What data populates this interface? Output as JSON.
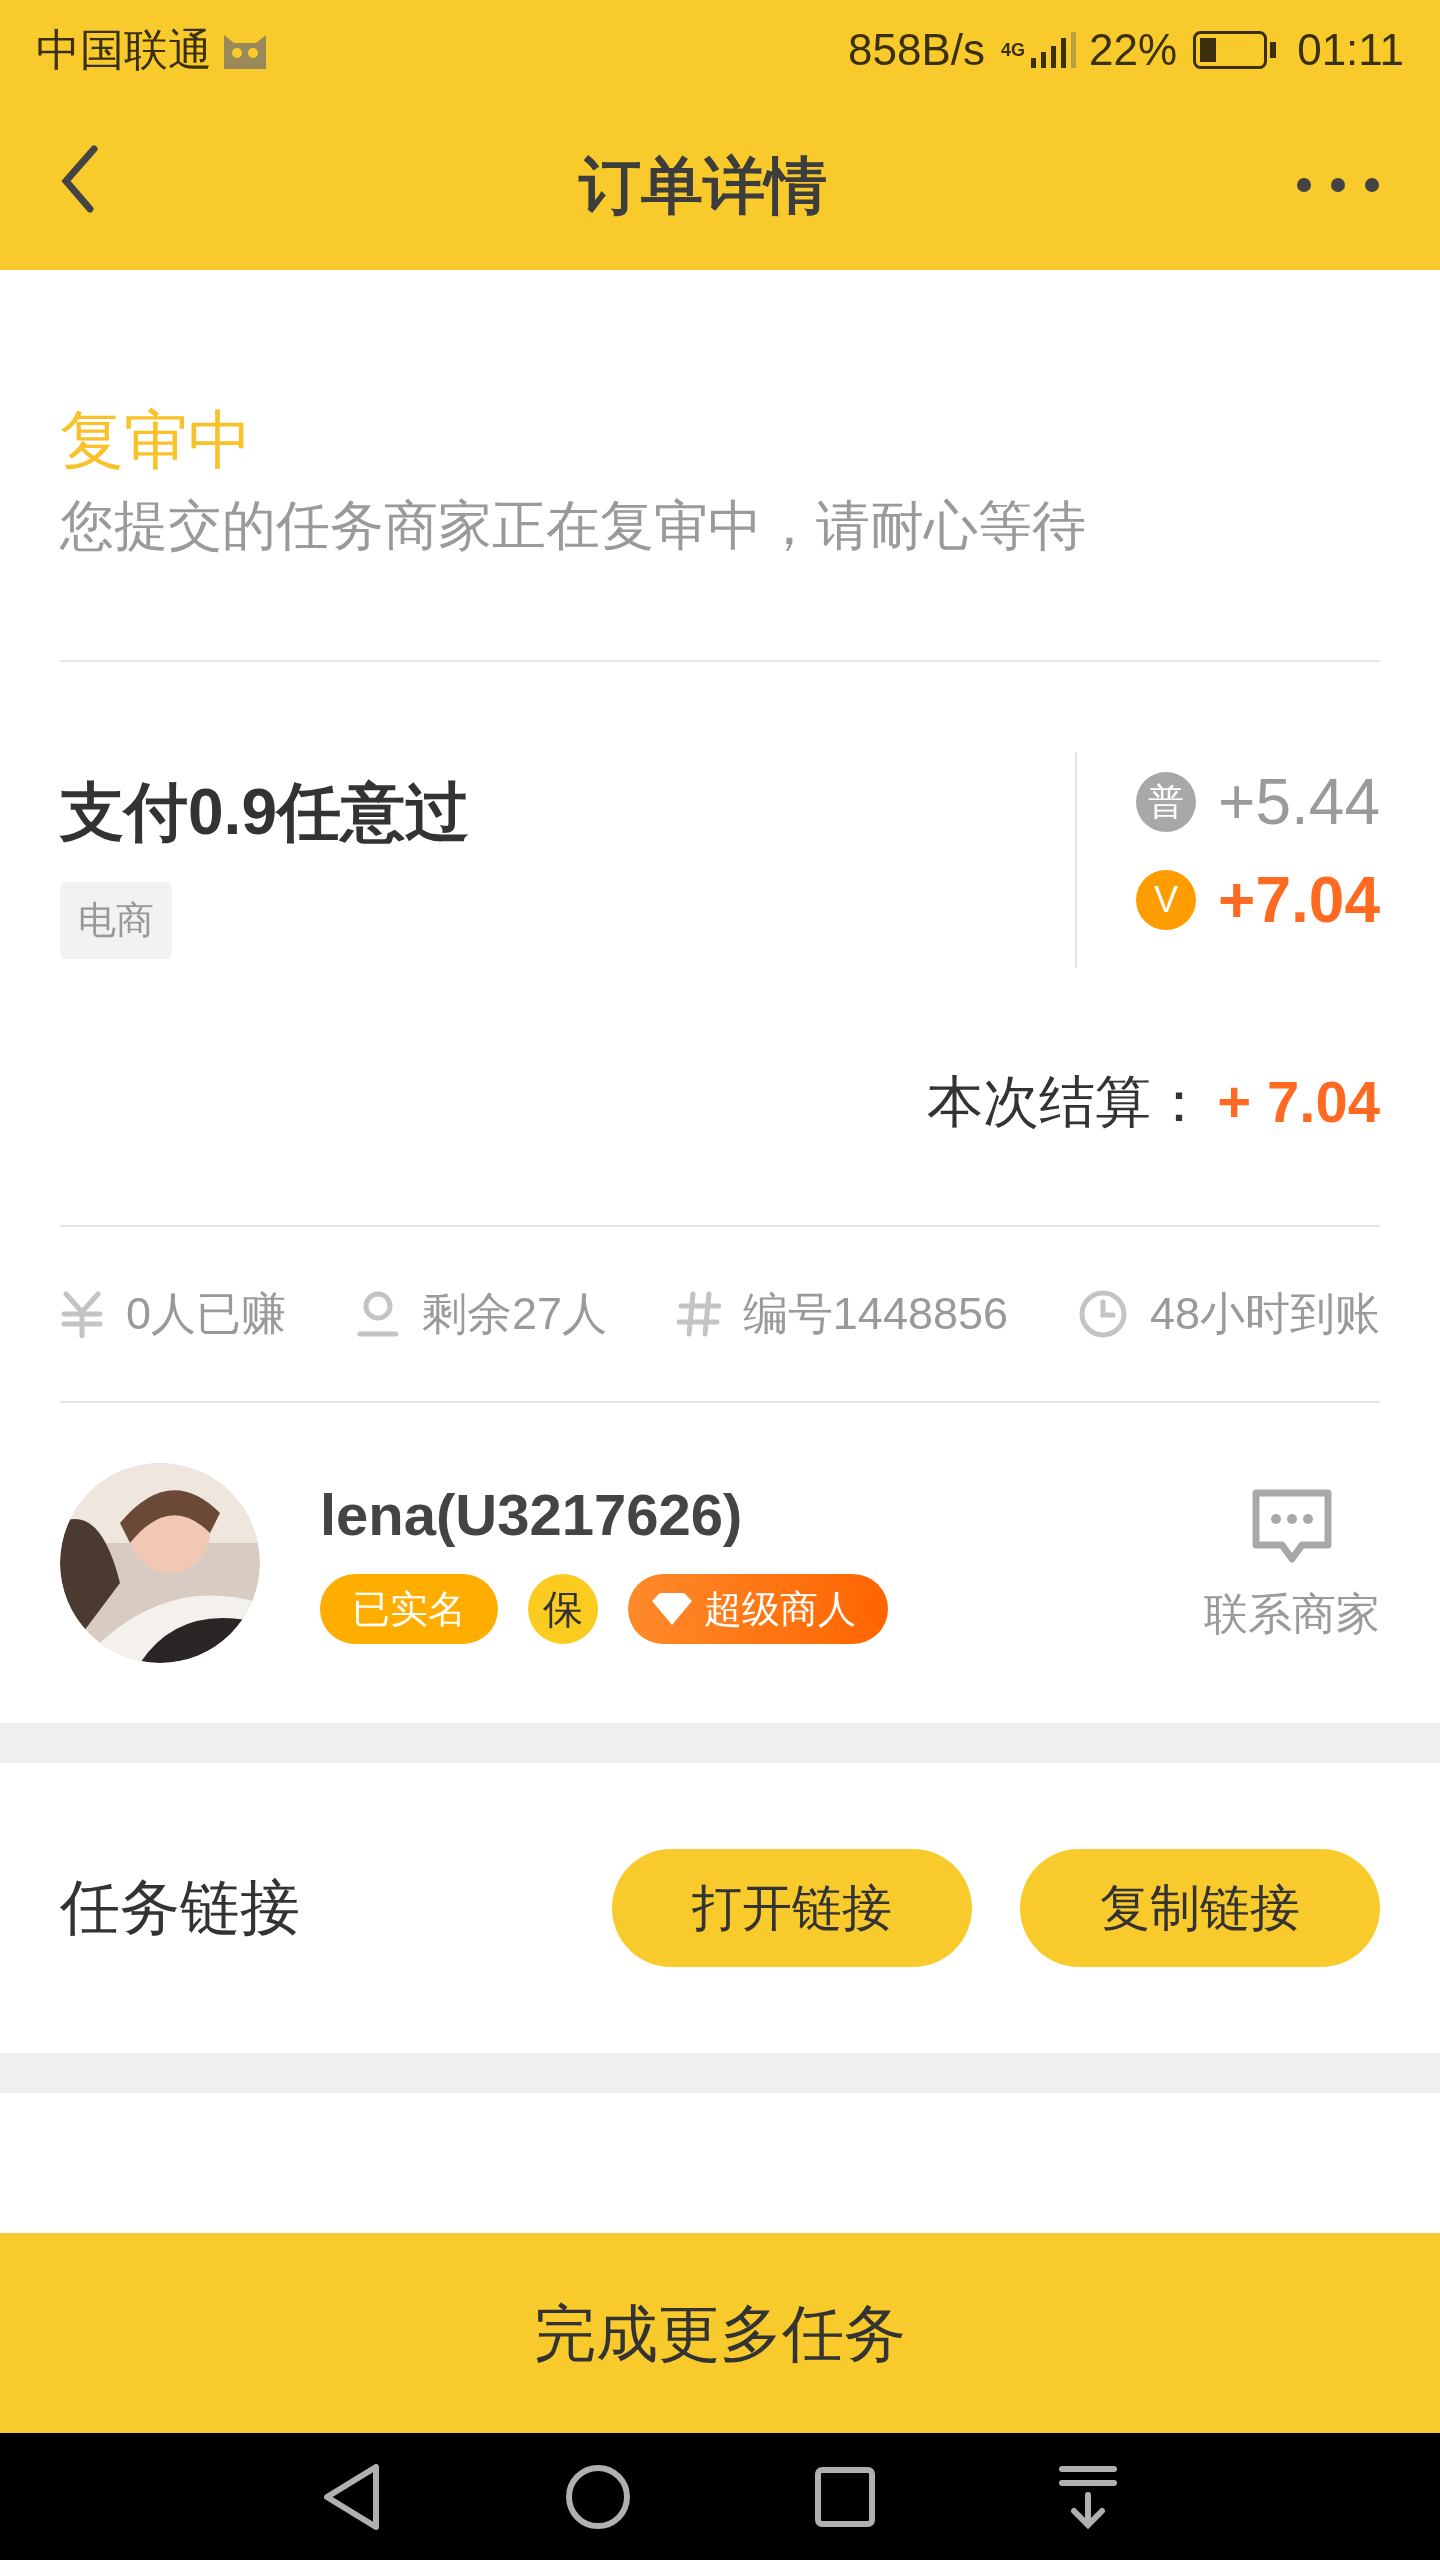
{
  "status_bar": {
    "carrier": "中国联通",
    "speed": "858B/s",
    "network": "4G",
    "battery": "22%",
    "time": "01:11"
  },
  "header": {
    "title": "订单详情"
  },
  "review": {
    "title": "复审中",
    "message": "您提交的任务商家正在复审中，请耐心等待"
  },
  "task": {
    "title": "支付0.9任意过",
    "tag": "电商",
    "prices": [
      {
        "kind": "normal",
        "badge": "普",
        "value": "+5.44"
      },
      {
        "kind": "vip",
        "badge": "V",
        "value": "+7.04"
      }
    ],
    "settlement": {
      "label": "本次结算：",
      "value": "+ 7.04"
    }
  },
  "stats": [
    {
      "kind": "yuan",
      "text": "0人已赚"
    },
    {
      "kind": "person",
      "text": "剩余27人"
    },
    {
      "kind": "hash",
      "text": "编号1448856"
    },
    {
      "kind": "clock",
      "text": "48小时到账"
    }
  ],
  "merchant": {
    "name": "lena(U3217626)",
    "badges": [
      {
        "kind": "verified",
        "text": "已实名"
      },
      {
        "kind": "guarantee",
        "text": "保"
      },
      {
        "kind": "super",
        "text": "超级商人"
      }
    ],
    "contact": "联系商家"
  },
  "link_section": {
    "title": "任务链接",
    "buttons": [
      "打开链接",
      "复制链接"
    ]
  },
  "bottom_button": "完成更多任务"
}
